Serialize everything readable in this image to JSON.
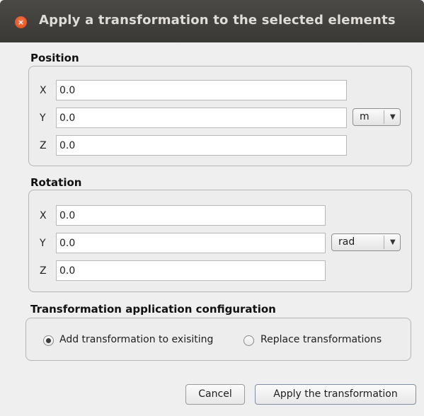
{
  "window": {
    "title": "Apply a transformation to the selected elements",
    "close_glyph": "×"
  },
  "position": {
    "title": "Position",
    "fields": [
      {
        "axis": "X",
        "value": "0.0"
      },
      {
        "axis": "Y",
        "value": "0.0"
      },
      {
        "axis": "Z",
        "value": "0.0"
      }
    ],
    "unit": "m"
  },
  "rotation": {
    "title": "Rotation",
    "fields": [
      {
        "axis": "X",
        "value": "0.0"
      },
      {
        "axis": "Y",
        "value": "0.0"
      },
      {
        "axis": "Z",
        "value": "0.0"
      }
    ],
    "unit": "rad"
  },
  "config": {
    "title": "Transformation application configuration",
    "options": [
      {
        "label": "Add transformation to exisiting",
        "selected": true
      },
      {
        "label": "Replace transformations",
        "selected": false
      }
    ]
  },
  "buttons": {
    "cancel": "Cancel",
    "apply": "Apply the transformation"
  },
  "icons": {
    "dropdown_arrow": "▼"
  },
  "colors": {
    "titlebar": "#3c3b37",
    "close": "#e9541f",
    "background": "#efefef"
  }
}
